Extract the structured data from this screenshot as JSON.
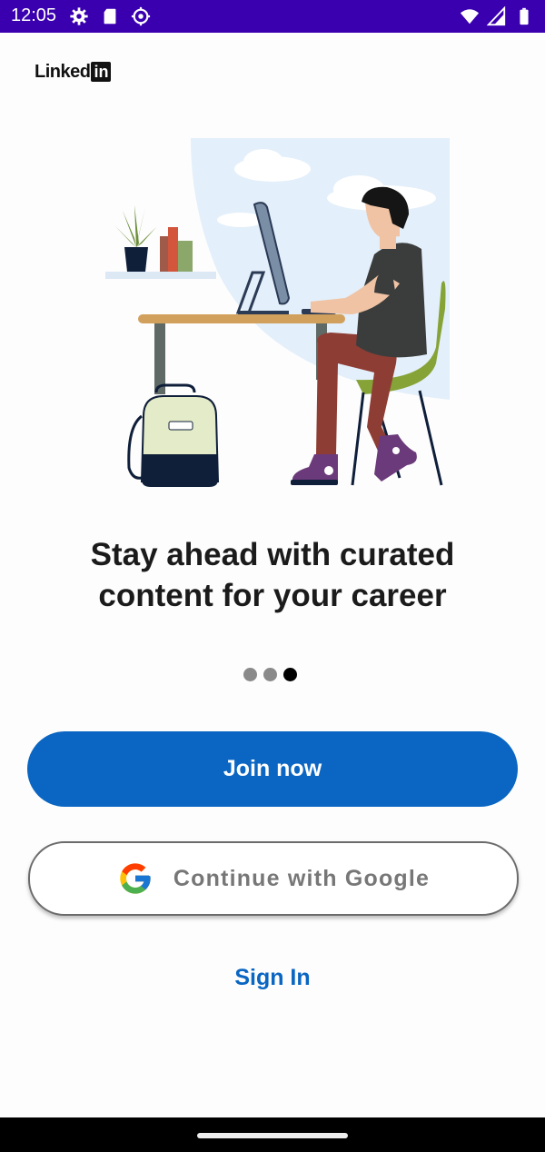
{
  "status_bar": {
    "time": "12:05",
    "left_icons": [
      "settings-icon",
      "sd-card-icon",
      "vpn-icon"
    ],
    "right_icons": [
      "wifi-icon",
      "cell-signal-icon",
      "battery-icon"
    ],
    "color": "#3a00b0"
  },
  "logo": {
    "word": "Linked",
    "box": "in"
  },
  "onboarding": {
    "headline_line1": "Stay ahead with curated",
    "headline_line2": "content for your career",
    "page_count": 3,
    "current_page": 3
  },
  "actions": {
    "join_label": "Join now",
    "google_label": "Continue with Google",
    "signin_label": "Sign In"
  },
  "colors": {
    "accent": "#0a66c2"
  }
}
